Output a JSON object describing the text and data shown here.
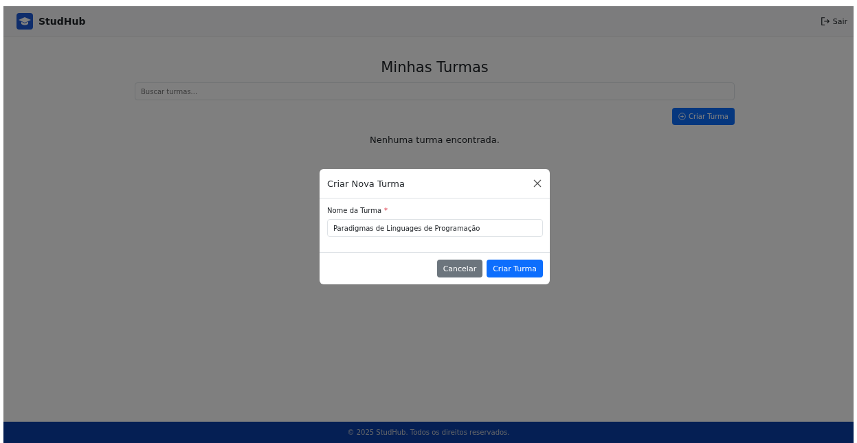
{
  "navbar": {
    "brand": "StudHub",
    "logout": "Sair"
  },
  "main": {
    "title": "Minhas Turmas",
    "search": {
      "placeholder": "Buscar turmas..."
    },
    "create_button": "Criar Turma",
    "empty_message": "Nenhuma turma encontrada."
  },
  "modal": {
    "title": "Criar Nova Turma",
    "field": {
      "label": "Nome da Turma",
      "required_mark": "*",
      "value": "Paradigmas de Linguages de Programação"
    },
    "buttons": [
      {
        "label": "Cancelar",
        "kind": "secondary"
      },
      {
        "label": "Criar Turma",
        "kind": "primary"
      }
    ]
  },
  "footer": "© 2025 StudHub. Todos os direitos reservados."
}
